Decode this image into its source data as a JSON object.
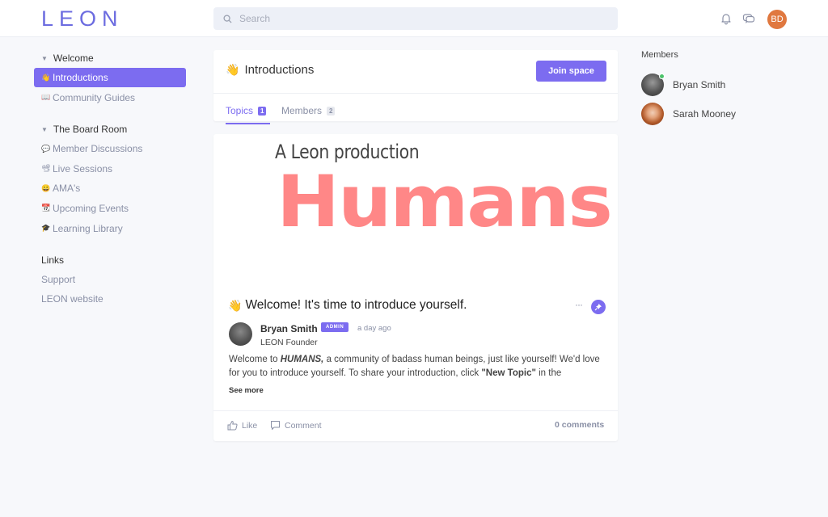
{
  "app": {
    "logo": "LEON",
    "search": {
      "placeholder": "Search",
      "value": ""
    },
    "user_initials": "BD",
    "colors": {
      "accent": "#7c6cf0",
      "logo": "#6c6ce0",
      "avatar": "#e0783f",
      "cover_title": "#ff8787",
      "online": "#4cc26b"
    }
  },
  "sidebar": {
    "sections": [
      {
        "title": "Welcome",
        "items": [
          {
            "icon": "👋",
            "icon_name": "waving-hand-icon",
            "label": "Introductions",
            "active": true
          },
          {
            "icon": "📖",
            "icon_name": "book-icon",
            "label": "Community Guides",
            "active": false
          }
        ]
      },
      {
        "title": "The Board Room",
        "items": [
          {
            "icon": "💬",
            "icon_name": "speech-bubble-icon",
            "label": "Member Discussions",
            "active": false
          },
          {
            "icon": "📽",
            "icon_name": "projector-icon",
            "label": "Live Sessions",
            "active": false
          },
          {
            "icon": "😀",
            "icon_name": "smiley-icon",
            "label": "AMA's",
            "active": false
          },
          {
            "icon": "📆",
            "icon_name": "calendar-icon",
            "label": "Upcoming Events",
            "active": false
          },
          {
            "icon": "🎓",
            "icon_name": "graduation-cap-icon",
            "label": "Learning Library",
            "active": false
          }
        ]
      }
    ],
    "links": {
      "title": "Links",
      "items": [
        "Support",
        "LEON website"
      ]
    }
  },
  "space": {
    "icon": "👋",
    "title": "Introductions",
    "join_label": "Join space",
    "tabs": [
      {
        "label": "Topics",
        "count": "1",
        "active": true
      },
      {
        "label": "Members",
        "count": "2",
        "active": false
      }
    ]
  },
  "post": {
    "cover": {
      "subtitle": "A Leon production",
      "title": "Humans"
    },
    "icon": "👋",
    "title": "Welcome! It's time to introduce yourself.",
    "more_label": "···",
    "author": {
      "name": "Bryan Smith",
      "badge": "ADMIN",
      "role": "LEON Founder"
    },
    "time": "a day ago",
    "body": {
      "prefix": "Welcome to ",
      "emphasis": "HUMANS,",
      "middle": " a community of badass human beings, just like yourself! We'd love for you to introduce yourself. To share your introduction, click ",
      "strong": "\"New Topic\"",
      "suffix": " in the"
    },
    "see_more": "See more",
    "actions": {
      "like": "Like",
      "comment": "Comment",
      "count": "0 comments"
    }
  },
  "members_panel": {
    "title": "Members",
    "members": [
      {
        "name": "Bryan Smith",
        "online": true
      },
      {
        "name": "Sarah Mooney",
        "online": false
      }
    ]
  }
}
